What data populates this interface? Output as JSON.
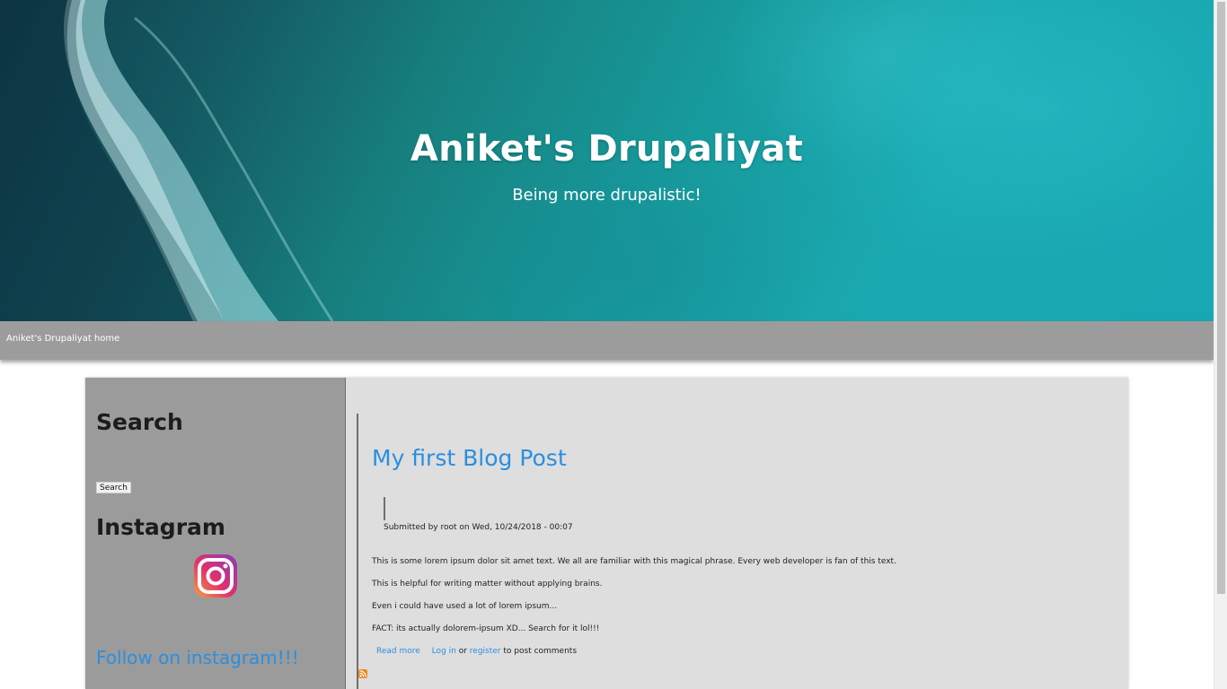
{
  "header": {
    "site_name": "Aniket's Drupaliyat",
    "slogan": "Being more drupalistic!"
  },
  "nav": {
    "home_link": "Aniket's Drupaliyat home"
  },
  "sidebar": {
    "search_title": "Search",
    "search_button": "Search",
    "instagram_title": "Instagram",
    "follow_link": "Follow on instagram!!!"
  },
  "article": {
    "title": "My first Blog Post",
    "submitted": "Submitted by root on Wed, 10/24/2018 - 00:07",
    "paragraphs": [
      "This is some lorem ipsum dolor sit amet text. We all are familiar with this magical phrase. Every web developer is fan of this text.",
      "This is helpful for writing matter without applying brains.",
      "Even i could have used a lot of lorem ipsum...",
      "FACT: its actually dolorem-ipsum XD... Search for it lol!!!"
    ],
    "read_more": "Read more",
    "login": "Log in",
    "or": "or",
    "register": "register",
    "post_comments": "to post comments"
  },
  "colors": {
    "link": "#2a8fe0",
    "navbar": "#9c9c9c",
    "sidebar": "#9b9b9b",
    "content_bg": "#dedede"
  },
  "icons": [
    "instagram-icon",
    "rss-feed-icon"
  ]
}
